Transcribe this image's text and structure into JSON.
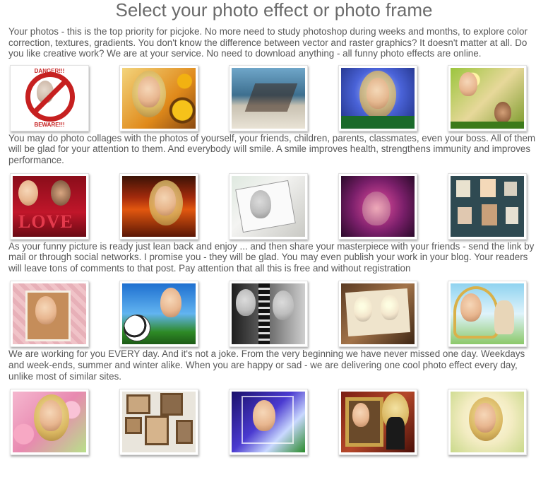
{
  "page": {
    "title": "Select your photo effect or photo frame"
  },
  "paragraphs": [
    "Your photos - this is the top priority for picjoke. No more need to study photoshop during weeks and months, to explore color correction, textures, gradients. You don't know the difference between vector and raster graphics? It doesn't matter at all. Do you like creative work? We are at your service. No need to download anything - all funny photo effects are online.",
    "You may do photo collages with the photos of yourself, your friends, children, parents, classmates, even your boss. All of them will be glad for your attention to them. And everybody will smile. A smile improves health, strengthens immunity and improves performance.",
    "As your funny picture is ready just lean back and enjoy ... and then share your masterpiece with your friends - send the link by mail or through social networks. I promise you - they will be glad. You may even publish your work in your blog. Your readers will leave tons of comments to that post. Pay attention that all this is free and without registration",
    "We are working for you EVERY day. And it's not a joke. From the very beginning we have never missed one day. Weekdays and week-ends, summer and winter alike. When you are happy or sad - we are delivering one cool photo effect every day, unlike most of similar sites."
  ],
  "thumb_text": {
    "danger_top": "DANGER!!!",
    "danger_bottom": "BEWARE!!!",
    "love": "LOVE"
  },
  "colors": {
    "title": "#6b6b6b",
    "text": "#585858",
    "danger": "#c62020"
  }
}
